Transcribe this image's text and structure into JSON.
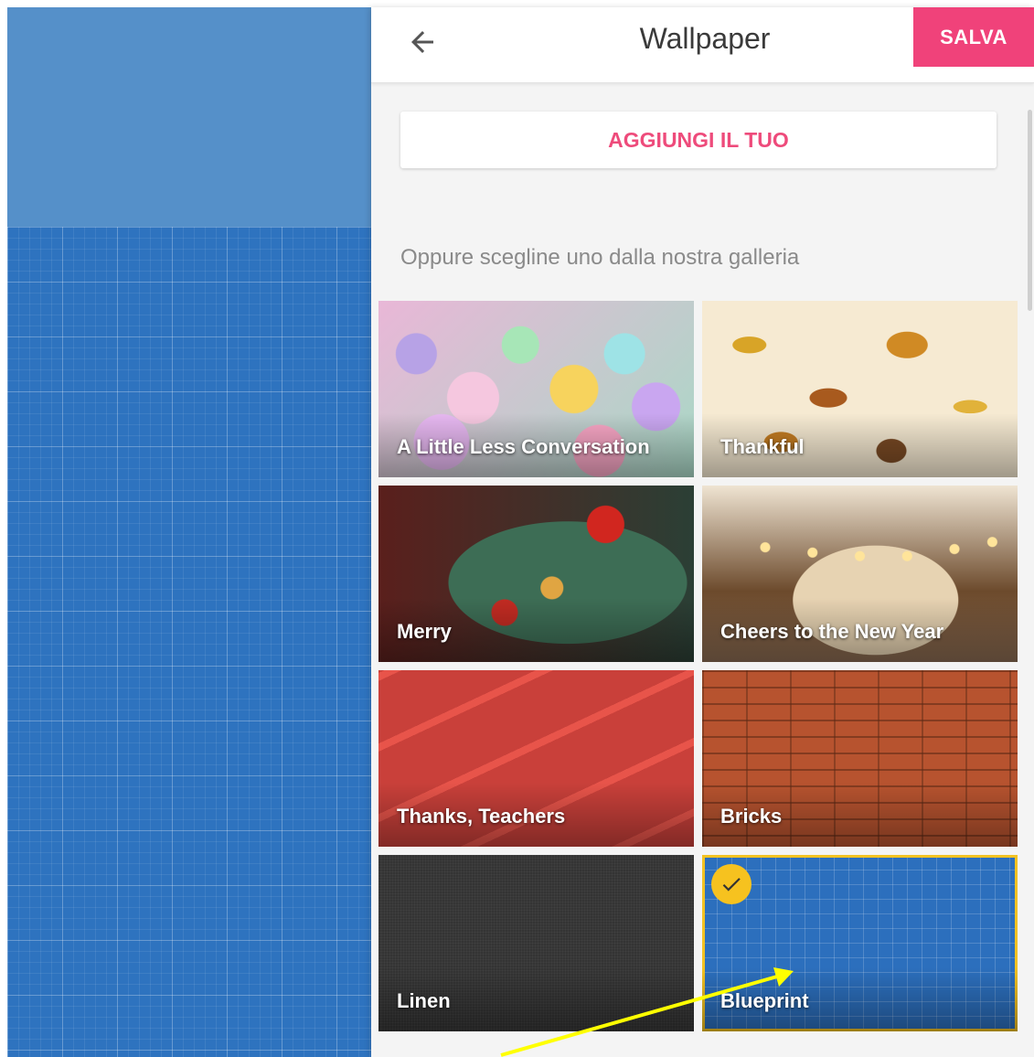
{
  "header": {
    "title": "Wallpaper",
    "save_label": "SALVA",
    "back_icon": "arrow-back-icon"
  },
  "actions": {
    "add_own_label": "AGGIUNGI IL TUO"
  },
  "gallery": {
    "subtitle": "Oppure scegline uno dalla nostra galleria",
    "selected": "Blueprint",
    "items": [
      {
        "label": "A Little Less Conversation"
      },
      {
        "label": "Thankful"
      },
      {
        "label": "Merry"
      },
      {
        "label": "Cheers to the New Year"
      },
      {
        "label": "Thanks, Teachers"
      },
      {
        "label": "Bricks"
      },
      {
        "label": "Linen"
      },
      {
        "label": "Blueprint"
      }
    ]
  },
  "colors": {
    "accent": "#f0427a",
    "selection": "#f6c21f",
    "blueprint": "#2e73bf",
    "annotation_arrow": "#ffff00"
  }
}
